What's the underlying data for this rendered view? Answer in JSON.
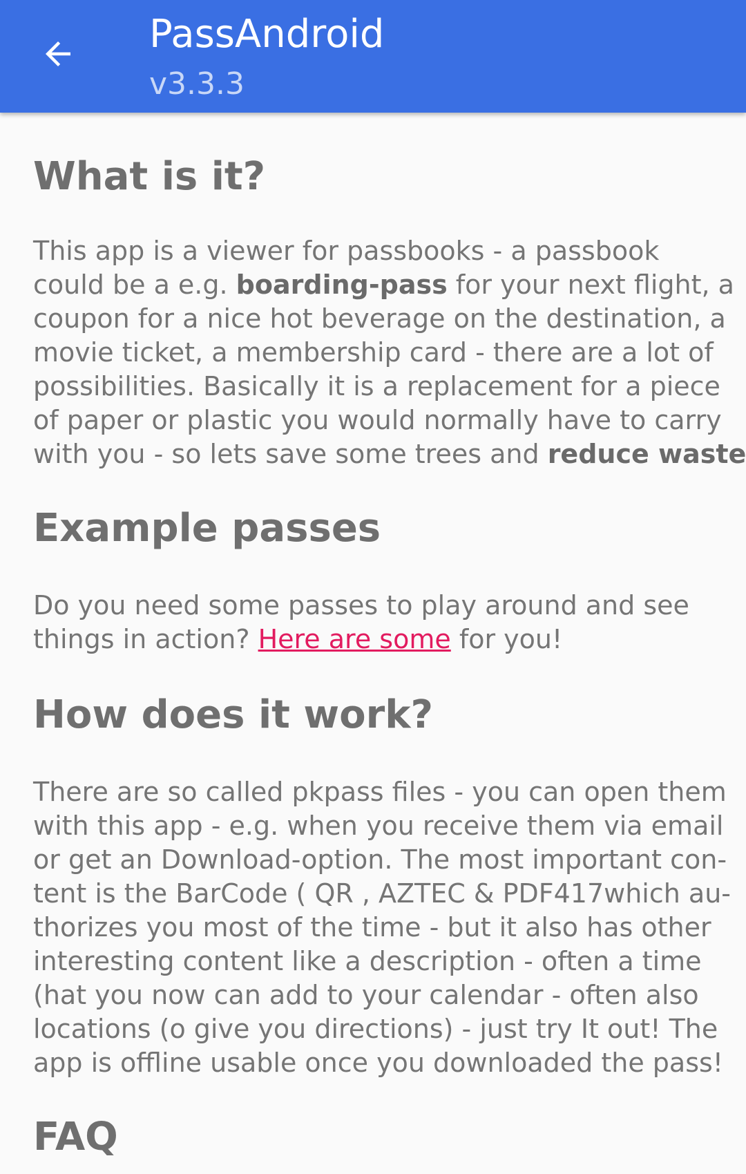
{
  "appbar": {
    "title": "PassAndroid",
    "subtitle": "v3.3.3",
    "back_icon": "arrow-back-icon",
    "color": "#3a6fe3"
  },
  "sections": {
    "what": {
      "heading": "What is it?",
      "lines": [
        "This app is a viewer for passbooks - a passbook",
        "could be a e.g. ",
        "boarding-pass",
        " for your next flight, a",
        "coupon for a nice hot beverage on the destination, a",
        "movie ticket, a membership card - there are a lot of",
        "possibilities. Basically it is a replacement for a piece",
        "of paper or plastic you would normally have to carry",
        "with you - so lets save some trees and ",
        "reduce waste!"
      ]
    },
    "example": {
      "heading": "Example passes",
      "line1": "Do you need some passes to play around and see",
      "line2_before": "things in action? ",
      "link_text": "Here are some",
      "line2_after": " for you!",
      "link_color": "#e21b5f"
    },
    "how": {
      "heading": "How does it work?",
      "lines": [
        "There are so called pkpass files - you can open them",
        "with this app - e.g. when you receive them via email",
        "or get an Download-option. The most important con-",
        "tent is the BarCode ( QR , AZTEC & PDF417which au-",
        "thorizes you most of the time - but it also has other",
        "interesting content like a description - often a time",
        "(hat you now can add to your calendar - often also",
        "locations (o give you directions) - just try It out! The",
        "app is offline usable once you downloaded the pass!"
      ]
    },
    "faq": {
      "heading": "FAQ"
    }
  }
}
